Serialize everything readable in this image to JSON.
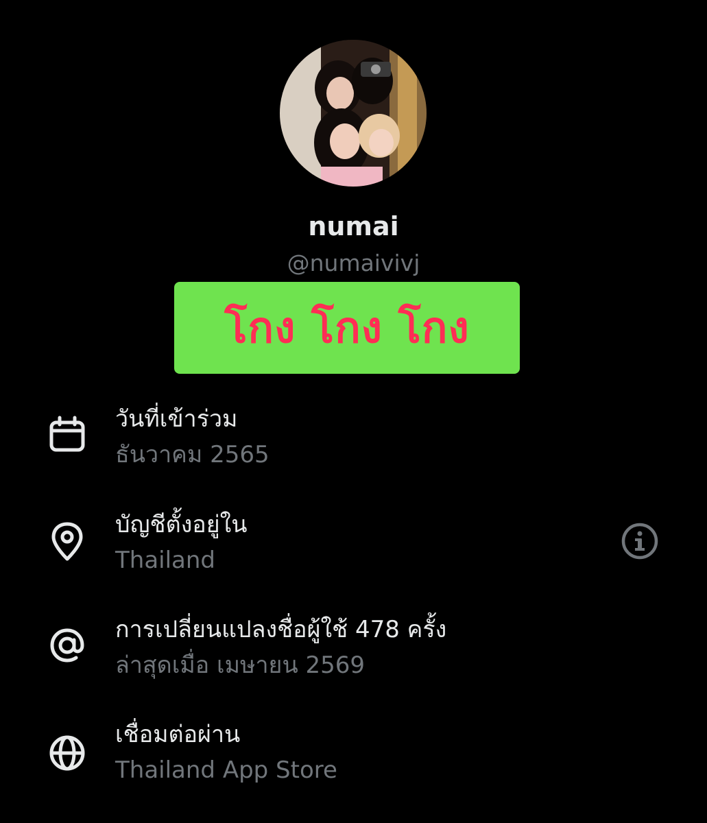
{
  "profile": {
    "display_name": "numai",
    "handle": "@numaivivj"
  },
  "banner": {
    "text": "โกง โกง โกง",
    "background_color": "#6fe34f",
    "text_color": "#ff2d55"
  },
  "about": {
    "joined": {
      "icon": "calendar-icon",
      "label": "วันที่เข้าร่วม",
      "value": "ธันวาคม 2565"
    },
    "location": {
      "icon": "location-pin-icon",
      "label": "บัญชีตั้งอยู่ใน",
      "value": "Thailand",
      "info_icon": "info-icon"
    },
    "username_changes": {
      "icon": "at-sign-icon",
      "label": "การเปลี่ยนแปลงชื่อผู้ใช้ 478 ครั้ง",
      "value": "ล่าสุดเมื่อ เมษายน 2569"
    },
    "connected_via": {
      "icon": "globe-icon",
      "label": "เชื่อมต่อผ่าน",
      "value": "Thailand App Store"
    }
  },
  "colors": {
    "background": "#000000",
    "primary_text": "#e7e9ea",
    "secondary_text": "#71767b"
  }
}
